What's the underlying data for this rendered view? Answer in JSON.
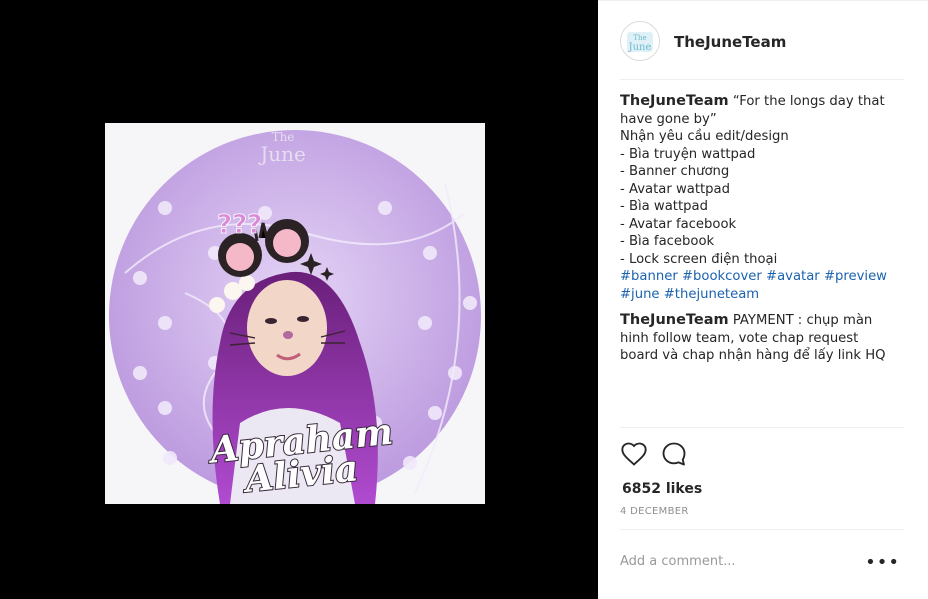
{
  "post": {
    "image_title_line1": "Apraham",
    "image_title_line2": "Alivia",
    "image_question_marks": "???",
    "image_logo_line1": "The",
    "image_logo_line2": "June"
  },
  "header": {
    "username": "TheJuneTeam",
    "avatar_logo_line1": "The",
    "avatar_logo_line2": "June"
  },
  "caption": {
    "username": "TheJuneTeam",
    "lines": [
      "“For the longs day that",
      "have gone by”",
      "Nhận yêu cầu edit/design",
      "- Bìa truyện wattpad",
      "- Banner chương",
      "- Avatar wattpad",
      "- Bìa wattpad",
      "- Avatar facebook",
      "- Bìa facebook",
      "- Lock screen điện thoại"
    ],
    "hashtags_line1": [
      "#banner",
      "#bookcover",
      "#avatar",
      "#preview"
    ],
    "hashtags_line2": [
      "#june",
      "#thejuneteam"
    ]
  },
  "comment": {
    "username": "TheJuneTeam",
    "text_line1": "PAYMENT : chụp màn",
    "text_line2": "hinh follow team, vote chap request",
    "text_line3": "board và chap nhận hàng để lấy link HQ"
  },
  "actions": {
    "like_icon": "heart-icon",
    "comment_icon": "speech-bubble-icon"
  },
  "likes": "6852 likes",
  "date": "4 DECEMBER",
  "add_comment": {
    "placeholder": "Add a comment...",
    "more": "•••"
  },
  "colors": {
    "hashtag": "#1c63b0",
    "image_purple": "#c9aee6"
  }
}
